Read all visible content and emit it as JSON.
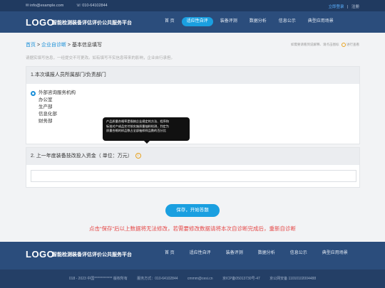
{
  "topbar": {
    "email": "info@example.com",
    "phone": "010-64102844",
    "login": "立即登录",
    "separator": "|",
    "register": "注册"
  },
  "header": {
    "logo": "LOGO",
    "title": "智能检测装备评估评价公共服务平台",
    "nav": [
      {
        "label": "首 页"
      },
      {
        "label": "适应性自评"
      },
      {
        "label": "装备评测"
      },
      {
        "label": "数据分析"
      },
      {
        "label": "信息公示"
      },
      {
        "label": "典型应用场景"
      }
    ]
  },
  "breadcrumb": {
    "home": "首页",
    "sep1": " > ",
    "section": "企业自诊断",
    "sep2": " > ",
    "current": "基本信息填写",
    "right_text": "如需要请看到说解释、请点击图标",
    "right_link": "进行查看"
  },
  "notice": "请据实填写信息，一经提交不可更改。如有填写不实信息带来的影响，企业自行承担。",
  "question1": {
    "title": "1.本次填报人员所属部门/负责部门",
    "options": [
      {
        "label": "外部咨询服务机构",
        "selected": true
      },
      {
        "label": "办公室"
      },
      {
        "label": "生产部"
      },
      {
        "label": "信息化部"
      },
      {
        "label": "财务部"
      }
    ]
  },
  "tooltip": {
    "line1": "产品质量合格率是指按企业规定的方法、程序和",
    "line2": "标准对产成品交付前实施质量抽样检测，判定为",
    "line3": "质量合格的样品数占全部抽样样品数的百分比"
  },
  "question2": {
    "title": "2. 上一年度装备技改投入资金（ 单位：万元）",
    "info_icon": "i",
    "value": ""
  },
  "submit_label": "保存，开始答题",
  "warning": "点击“保存”后以上数据将无法修改，若需要修改数据请将本次自诊断完成后，重新自诊断",
  "footer": {
    "logo": "LOGO",
    "title": "智能检测装备评估评价公共服务平台",
    "nav": [
      {
        "label": "首 页"
      },
      {
        "label": "适应性自评"
      },
      {
        "label": "装备评测"
      },
      {
        "label": "数据分析"
      },
      {
        "label": "信息公示"
      },
      {
        "label": "典型应用场景"
      }
    ],
    "copyright": "018 - 2023 中国************* 版权所有",
    "hotline": "服务方式：010-64102844",
    "email": "cmmm@cesi.cn",
    "icp": "京ICP备05013730号-47",
    "police": "京公网安备 11010102004488"
  }
}
